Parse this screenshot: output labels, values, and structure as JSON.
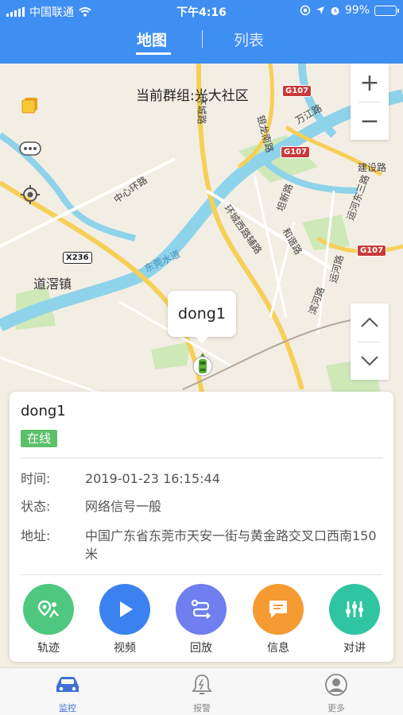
{
  "status_bar": {
    "carrier": "中国联通",
    "time": "下午4:16",
    "battery_text": "99%",
    "battery_level": 0.99,
    "battery_color": "#4cd964"
  },
  "nav": {
    "tabs": [
      {
        "label": "地图",
        "active": true
      },
      {
        "label": "列表",
        "active": false
      }
    ]
  },
  "map": {
    "group_label": "当前群组:光大社区",
    "town_label": "道滘镇",
    "road_labels": [
      "中心环路",
      "东莞水道",
      "环城西路辅路",
      "坦新路",
      "和谐路",
      "运河东三路",
      "建设路",
      "万江路",
      "银龙南路",
      "滨河路",
      "运河路",
      "环城路"
    ],
    "highway_badges": [
      "G107",
      "G107",
      "G107"
    ],
    "route_badge": "X236",
    "zoom_in": "+",
    "zoom_out": "−",
    "marker": {
      "name": "dong1"
    }
  },
  "device_card": {
    "name": "dong1",
    "status": "在线",
    "status_color": "#5cc06a",
    "rows": [
      {
        "label": "时间:",
        "value": "2019-01-23 16:15:44"
      },
      {
        "label": "状态:",
        "value": "网络信号一般"
      },
      {
        "label": "地址:",
        "value": "中国广东省东莞市天安一街与黄金路交叉口西南150米"
      }
    ],
    "actions": [
      {
        "label": "轨迹",
        "icon": "track-icon",
        "color": "#4fc77e"
      },
      {
        "label": "视频",
        "icon": "play-icon",
        "color": "#3b82f0"
      },
      {
        "label": "回放",
        "icon": "playback-route-icon",
        "color": "#6f7fef"
      },
      {
        "label": "信息",
        "icon": "message-icon",
        "color": "#f59b31"
      },
      {
        "label": "对讲",
        "icon": "intercom-icon",
        "color": "#2fc5a0"
      }
    ]
  },
  "tabbar": {
    "items": [
      {
        "label": "监控",
        "icon": "car-icon",
        "active": true
      },
      {
        "label": "报警",
        "icon": "bell-icon",
        "active": false
      },
      {
        "label": "更多",
        "icon": "user-icon",
        "active": false
      }
    ],
    "active_color": "#3f6fd6"
  }
}
